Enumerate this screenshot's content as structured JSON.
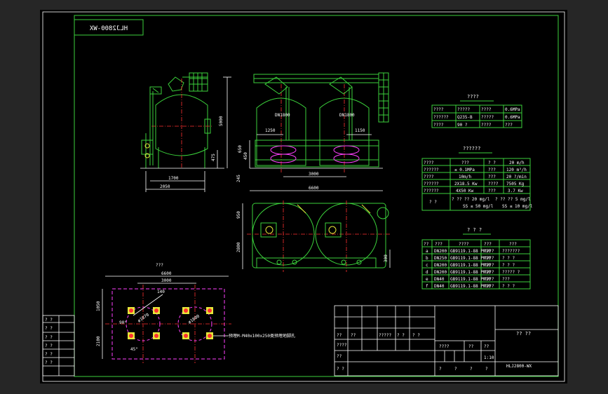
{
  "drawing": {
    "code_mirrored": "HLJ2800-WX",
    "code": "HLJ2800-WX",
    "sheet_title": "?? ??"
  },
  "dimensions": {
    "side_height": "5000",
    "side_base": "1700",
    "side_total": "2050",
    "side_small": "475",
    "front_left_dn": "DN1800",
    "front_right_dn": "DN1800",
    "front_left_offset": "1250",
    "front_right_offset": "1150",
    "front_height_a": "450",
    "front_height_b": "650",
    "front_base": "3000",
    "front_small": "245",
    "plan_width": "6600",
    "plan_height_a": "950",
    "plan_height_b": "2800",
    "plan_right": "300"
  },
  "foundation": {
    "title": "???",
    "width_total": "6600",
    "width_inner": "3000",
    "height_a": "1050",
    "height_b": "2100",
    "dim_r1": "ø1800",
    "dim_r2": "ø1070",
    "dim_angle": "140",
    "angle_a": "90°",
    "angle_b": "45°",
    "note": "预埋M-M40x100x250类预埋地脚孔"
  },
  "design_table": {
    "title": "????",
    "rows": [
      [
        "????",
        "?????",
        "????",
        "0.6MPa"
      ],
      [
        "??????",
        "Q235-B",
        "?????",
        "0.6MPa"
      ],
      [
        "????",
        "90 ?",
        "????",
        "???"
      ]
    ]
  },
  "tech_table": {
    "title": "??????",
    "rows": [
      [
        "????",
        "???",
        "? ?",
        "20 m/h"
      ],
      [
        "??????",
        "≤ 0.1MPa",
        "???",
        "120 m³/h"
      ],
      [
        "????",
        "10m/h",
        "???",
        "20 ?/min"
      ],
      [
        "??????",
        "2X18.5 Kw",
        "????",
        "7505 Kg"
      ],
      [
        "??????",
        "4X50 Kw",
        "???",
        "3.7 Kw"
      ]
    ],
    "last_label": "? ?",
    "last_a": "? ?? ?? 20 mg/l",
    "last_b": "? ?? ?? 5 mg/l",
    "last_c": "SS ≤ 50 mg/l",
    "last_d": "SS ≤ 10 mg/l"
  },
  "nozzle_table": {
    "title": "? ? ?",
    "header": [
      "??",
      "???",
      "????",
      "???",
      "???"
    ],
    "rows": [
      [
        "a",
        "DN200",
        "GB9119.1-88 PN10",
        "????",
        "???????"
      ],
      [
        "b",
        "DN250",
        "GB9119.1-88 PN10",
        "????",
        "? ? ?"
      ],
      [
        "c",
        "DN200",
        "GB9119.1-88 PN10",
        "????",
        "? ? ?"
      ],
      [
        "d",
        "DN200",
        "GB9119.1-88 PN10",
        "????",
        "????? ?"
      ],
      [
        "e",
        "DN40",
        "GB9119.1-88 PN10",
        "????",
        "???"
      ],
      [
        "f",
        "DN40",
        "GB9119.1-88 PN10",
        "????",
        "? ? ?"
      ]
    ]
  },
  "left_strip": {
    "labels": [
      "? ?",
      "? ?",
      "? ?",
      "? ?",
      "? ?",
      "? ?"
    ]
  },
  "title_block": {
    "cells": [
      "??",
      "??",
      "?????",
      "? ?",
      "? ?",
      "????",
      "??",
      "? ?",
      "?????",
      "?????",
      "? ?",
      "? ?",
      "? ?",
      "? ?",
      "?",
      "?"
    ],
    "scale_row": [
      "????",
      "??",
      "??"
    ],
    "scale": "1:10",
    "foot": [
      "?",
      "?",
      "?",
      "?"
    ]
  }
}
